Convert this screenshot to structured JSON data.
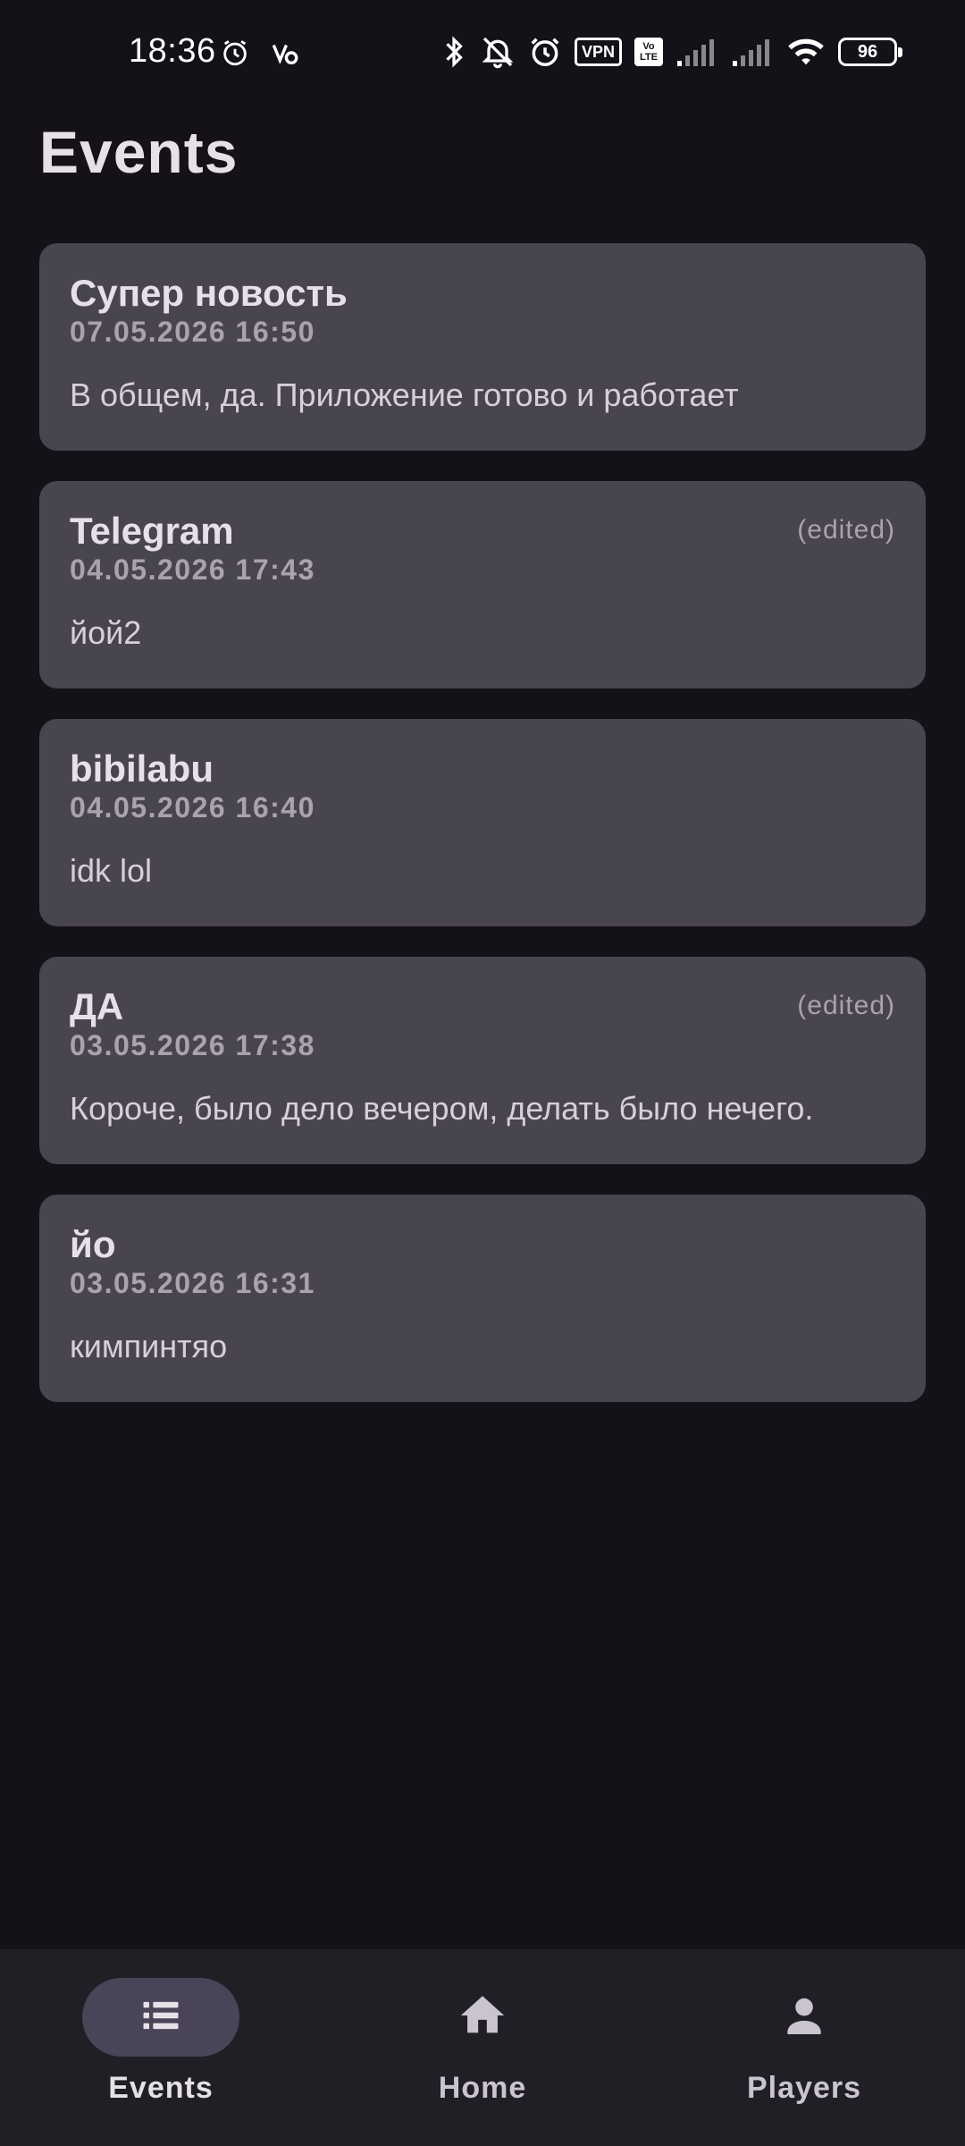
{
  "status_bar": {
    "time": "18:36",
    "vpn_label": "VPN",
    "volte_top": "Vo",
    "volte_bottom": "LTE",
    "battery": "96"
  },
  "header": {
    "title": "Events"
  },
  "events": [
    {
      "title": "Супер новость",
      "date": "07.05.2026 16:50",
      "body": "В общем, да. Приложение готово и работает",
      "edited": ""
    },
    {
      "title": "Telegram",
      "date": "04.05.2026 17:43",
      "body": "йой2",
      "edited": "(edited)"
    },
    {
      "title": "bibilabu",
      "date": "04.05.2026 16:40",
      "body": "idk lol",
      "edited": ""
    },
    {
      "title": "ДА",
      "date": "03.05.2026 17:38",
      "body": "Короче, было дело вечером, делать было нечего.",
      "edited": "(edited)"
    },
    {
      "title": "йо",
      "date": "03.05.2026 16:31",
      "body": "кимпинтяо",
      "edited": ""
    }
  ],
  "bottom_nav": {
    "items": [
      {
        "label": "Events",
        "icon": "list-icon",
        "active": true
      },
      {
        "label": "Home",
        "icon": "home-icon",
        "active": false
      },
      {
        "label": "Players",
        "icon": "person-icon",
        "active": false
      }
    ]
  },
  "colors": {
    "background": "#141218",
    "card": "#49454f",
    "nav_bar": "#211f26",
    "nav_active_pill": "#4a4458"
  }
}
